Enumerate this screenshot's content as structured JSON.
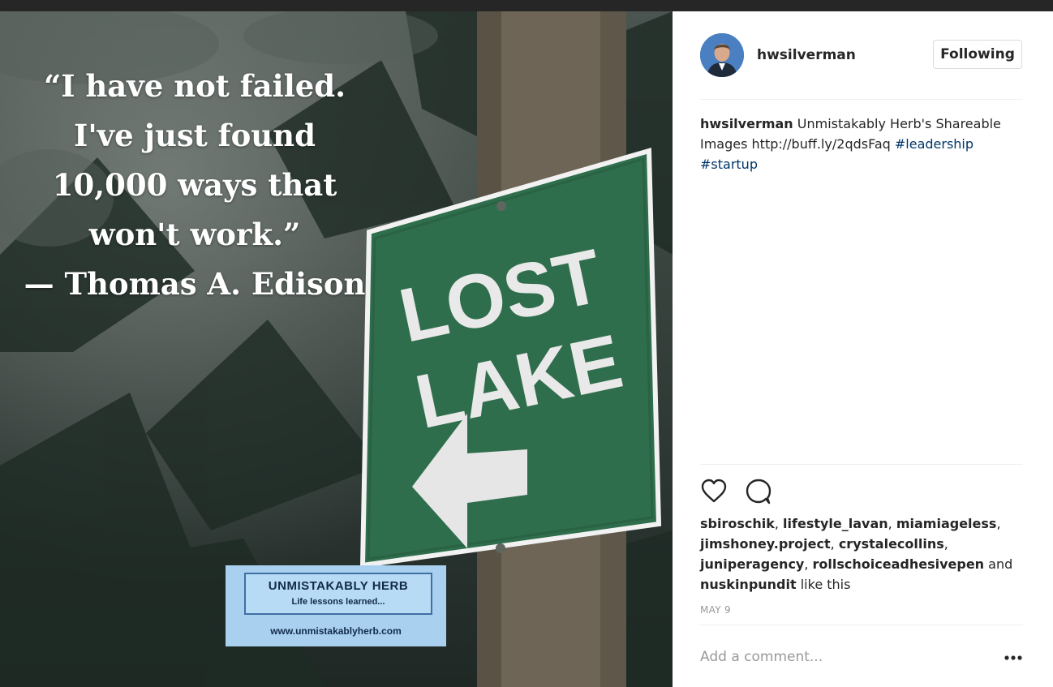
{
  "post_image": {
    "quote_lines": [
      "“I have not failed.",
      "I've just found",
      "10,000 ways that",
      "won't work.”",
      "— Thomas A. Edison"
    ],
    "sign_lines": [
      "LOST",
      "LAKE"
    ],
    "logo": {
      "name": "UNMISTAKABLY HERB",
      "tagline": "Life lessons learned...",
      "url": "www.unmistakablyherb.com"
    }
  },
  "header": {
    "username": "hwsilverman",
    "follow_label": "Following"
  },
  "caption": {
    "username": "hwsilverman",
    "text": "Unmistakably Herb's Shareable Images http://buff.ly/2qdsFaq",
    "hashtags": [
      "#leadership",
      "#startup"
    ]
  },
  "actions": {
    "like_icon": "heart-icon",
    "comment_icon": "comment-icon"
  },
  "likes": {
    "users": [
      "sbiroschik",
      "lifestyle_lavan",
      "miamiageless",
      "jimshoney.project",
      "crystalecollins",
      "juniperagency",
      "rollschoiceadhesivepen"
    ],
    "conjunction": "and",
    "last_user": "nuskinpundit",
    "suffix": "like this"
  },
  "date": "MAY 9",
  "comment": {
    "placeholder": "Add a comment..."
  },
  "more_icon": "more-options-icon",
  "colors": {
    "sign_green": "#2f6e4c",
    "hashtag_blue": "#003569",
    "logo_blue": "#a9d1ef"
  }
}
